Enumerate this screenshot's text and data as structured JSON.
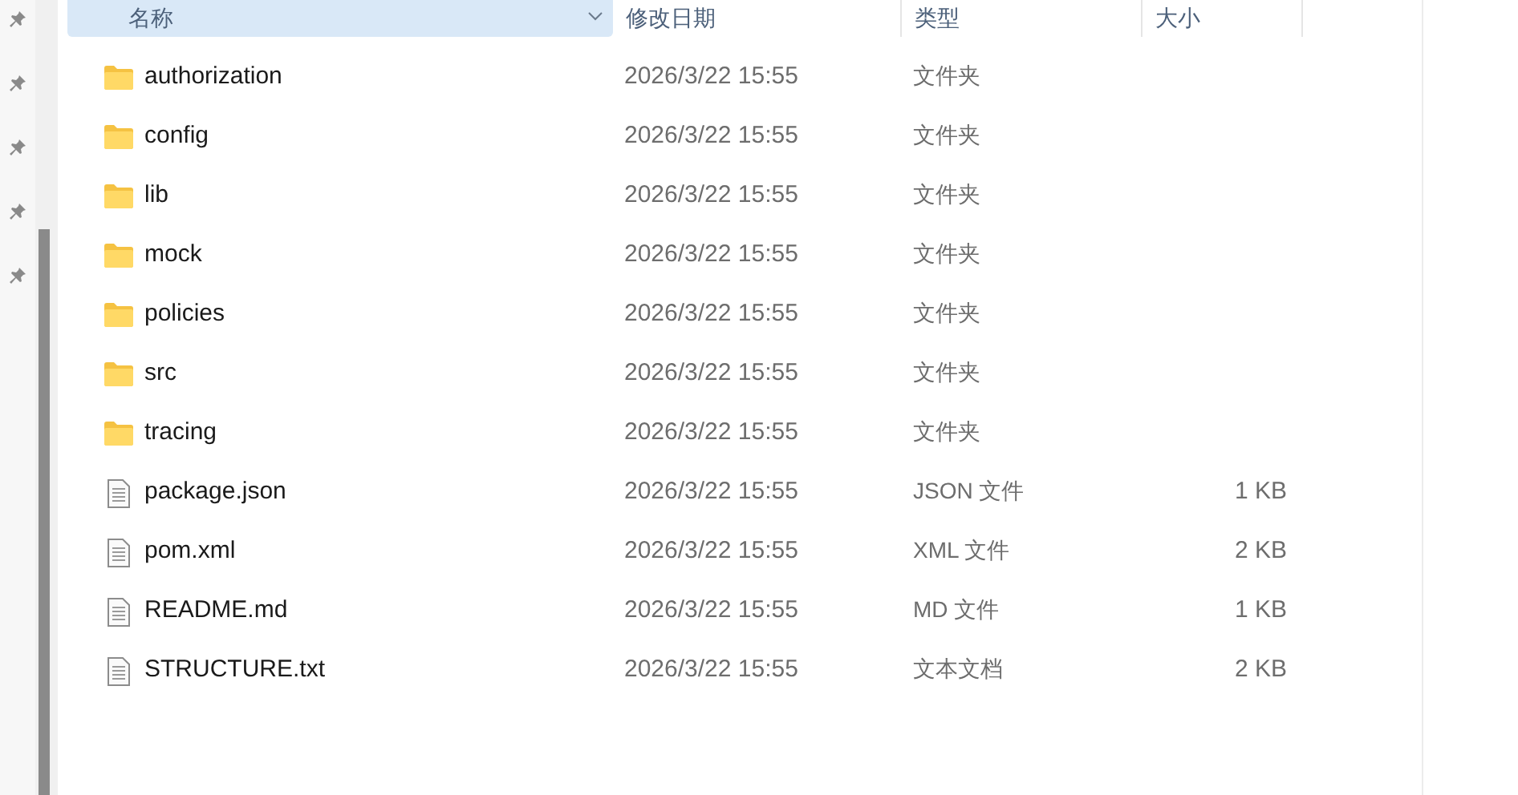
{
  "columns": [
    {
      "label": "名称",
      "selected": true
    },
    {
      "label": "修改日期",
      "selected": false
    },
    {
      "label": "类型",
      "selected": false
    },
    {
      "label": "大小",
      "selected": false
    }
  ],
  "quick_access": [
    {
      "pinned": true
    },
    {
      "pinned": true
    },
    {
      "pinned": true
    },
    {
      "pinned": true
    },
    {
      "pinned": true
    }
  ],
  "files": [
    {
      "kind": "folder",
      "name": "authorization",
      "date": "2026/3/22 15:55",
      "type": "文件夹"
    },
    {
      "kind": "folder",
      "name": "config",
      "date": "2026/3/22 15:55",
      "type": "文件夹"
    },
    {
      "kind": "folder",
      "name": "lib",
      "date": "2026/3/22 15:55",
      "type": "文件夹"
    },
    {
      "kind": "folder",
      "name": "mock",
      "date": "2026/3/22 15:55",
      "type": "文件夹"
    },
    {
      "kind": "folder",
      "name": "policies",
      "date": "2026/3/22 15:55",
      "type": "文件夹"
    },
    {
      "kind": "folder",
      "name": "src",
      "date": "2026/3/22 15:55",
      "type": "文件夹"
    },
    {
      "kind": "folder",
      "name": "tracing",
      "date": "2026/3/22 15:55",
      "type": "文件夹"
    },
    {
      "kind": "file",
      "name": "package.json",
      "date": "2026/3/22 15:55",
      "type": "JSON 文件",
      "size": "1 KB"
    },
    {
      "kind": "file",
      "name": "pom.xml",
      "date": "2026/3/22 15:55",
      "type": "XML 文件",
      "size": "2 KB"
    },
    {
      "kind": "file",
      "name": "README.md",
      "date": "2026/3/22 15:55",
      "type": "MD 文件",
      "size": "1 KB"
    },
    {
      "kind": "file",
      "name": "STRUCTURE.txt",
      "date": "2026/3/22 15:55",
      "type": "文本文档",
      "size": "2 KB"
    }
  ]
}
